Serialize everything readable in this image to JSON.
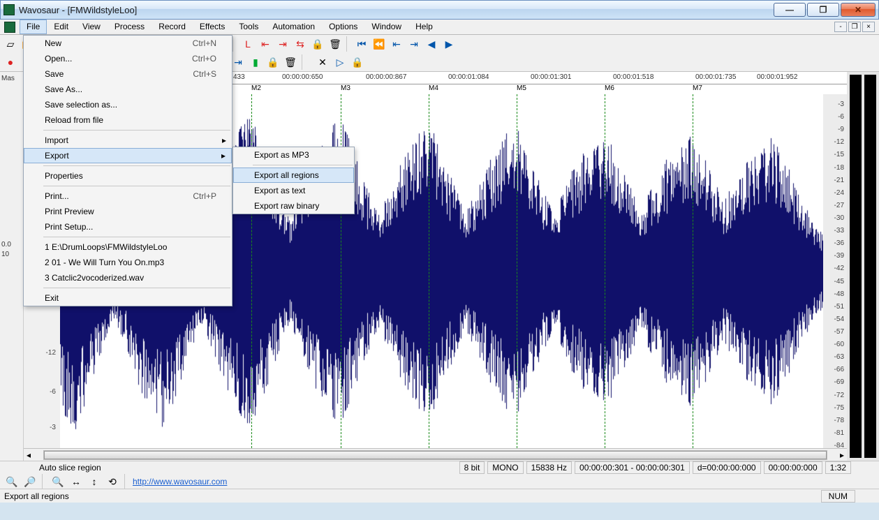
{
  "window": {
    "title": "Wavosaur - [FMWildstyleLoo]"
  },
  "menubar": [
    "File",
    "Edit",
    "View",
    "Process",
    "Record",
    "Effects",
    "Tools",
    "Automation",
    "Options",
    "Window",
    "Help"
  ],
  "file_menu": [
    {
      "label": "New",
      "accel": "Ctrl+N"
    },
    {
      "label": "Open...",
      "accel": "Ctrl+O"
    },
    {
      "label": "Save",
      "accel": "Ctrl+S"
    },
    {
      "label": "Save As..."
    },
    {
      "label": "Save selection as..."
    },
    {
      "label": "Reload from file"
    },
    {
      "sep": true
    },
    {
      "label": "Import",
      "submenu": true
    },
    {
      "label": "Export",
      "submenu": true,
      "hover": true
    },
    {
      "sep": true
    },
    {
      "label": "Properties"
    },
    {
      "sep": true
    },
    {
      "label": "Print...",
      "accel": "Ctrl+P"
    },
    {
      "label": "Print Preview"
    },
    {
      "label": "Print Setup..."
    },
    {
      "sep": true
    },
    {
      "label": "1 E:\\DrumLoops\\FMWildstyleLoo"
    },
    {
      "label": "2 01 - We Will Turn You On.mp3"
    },
    {
      "label": "3 Catclic2vocoderized.wav"
    },
    {
      "sep": true
    },
    {
      "label": "Exit"
    }
  ],
  "export_menu": [
    {
      "label": "Export as MP3"
    },
    {
      "sep": true
    },
    {
      "label": "Export all regions",
      "hover": true
    },
    {
      "label": "Export as text"
    },
    {
      "label": "Export raw binary"
    }
  ],
  "time_ticks": [
    "433",
    "00:00:00:650",
    "00:00:00:867",
    "00:00:01:084",
    "00:00:01:301",
    "00:00:01:518",
    "00:00:01:735",
    "00:00:01:952"
  ],
  "markers": [
    "M2",
    "M3",
    "M4",
    "M5",
    "M6",
    "M7"
  ],
  "right_scale": [
    "-3",
    "-6",
    "-9",
    "-12",
    "-15",
    "-18",
    "-21",
    "-24",
    "-27",
    "-30",
    "-33",
    "-36",
    "-39",
    "-42",
    "-45",
    "-48",
    "-51",
    "-54",
    "-57",
    "-60",
    "-63",
    "-66",
    "-69",
    "-72",
    "-75",
    "-78",
    "-81",
    "-84"
  ],
  "left_amp": [
    "-12",
    "-6",
    "-3"
  ],
  "left_panel": {
    "master": "Mas",
    "val1": "0.0",
    "val2": "10"
  },
  "bottom": {
    "hint": "Auto slice region",
    "link": "http://www.wavosaur.com"
  },
  "status": {
    "bits": "8 bit",
    "channels": "MONO",
    "rate": "15838 Hz",
    "range": "00:00:00:301 - 00:00:00:301",
    "dur": "d=00:00:00:000",
    "pos": "00:00:00:000",
    "zoom": "1:32",
    "num": "NUM",
    "hint": "Export all regions"
  }
}
